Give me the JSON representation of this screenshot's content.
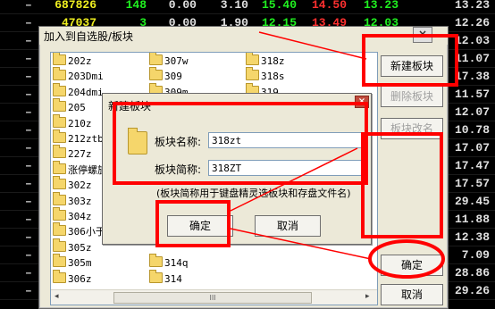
{
  "background_rows": [
    {
      "a": "687826",
      "b": "148",
      "c": "0.00",
      "d": "3.10",
      "e": "15.40",
      "f": "14.50",
      "g": "13.23",
      "h": "13.23"
    },
    {
      "a": "47037",
      "b": "3",
      "c": "0.00",
      "d": "1.90",
      "e": "12.15",
      "f": "13.49",
      "g": "12.03",
      "h": "12.26"
    },
    {
      "h": "12.03"
    },
    {
      "h": "11.07"
    },
    {
      "h": "17.38"
    },
    {
      "h": "11.57"
    },
    {
      "h": "12.07"
    },
    {
      "h": "10.78"
    },
    {
      "h": "17.07"
    },
    {
      "h": "17.47"
    },
    {
      "h": "17.57"
    },
    {
      "h": "29.45"
    },
    {
      "h": "11.88"
    },
    {
      "h": "12.38"
    },
    {
      "h": "7.09"
    },
    {
      "h": "28.86"
    },
    {
      "h": "29.26"
    }
  ],
  "dialog": {
    "title": "加入到自选股/板块",
    "close": "×",
    "folders": [
      [
        "202z",
        "203Dmi",
        "204dmi",
        "205",
        "210z",
        "212ztb",
        "227z",
        "涨停螺旋",
        "302z",
        "303z",
        "304z",
        "306小于",
        "305z",
        "305m",
        "306z"
      ],
      [
        "307w",
        "309",
        "309m",
        "",
        "",
        "",
        "",
        "",
        "",
        "",
        "",
        "",
        "",
        "314q",
        "314"
      ],
      [
        "318z",
        "318s",
        "319",
        "",
        "",
        "",
        "",
        "",
        "",
        "",
        "",
        "",
        "",
        "",
        ""
      ]
    ],
    "buttons": {
      "new_block": "新建板块",
      "delete_block": "删除板块",
      "rename_block": "板块改名",
      "ok": "确定",
      "cancel": "取消"
    },
    "scroll_arrows": {
      "left": "◂",
      "right": "▸",
      "thumb": "III"
    }
  },
  "new_block_dialog": {
    "title": "新建板块",
    "close": "×",
    "name_label": "板块名称:",
    "name_value": "318zt",
    "abbr_label": "板块简称:",
    "abbr_value": "318ZT",
    "hint": "(板块简称用于键盘精灵选板块和存盘文件名)",
    "ok": "确定",
    "cancel": "取消"
  },
  "annotation_color": "#ff0000"
}
